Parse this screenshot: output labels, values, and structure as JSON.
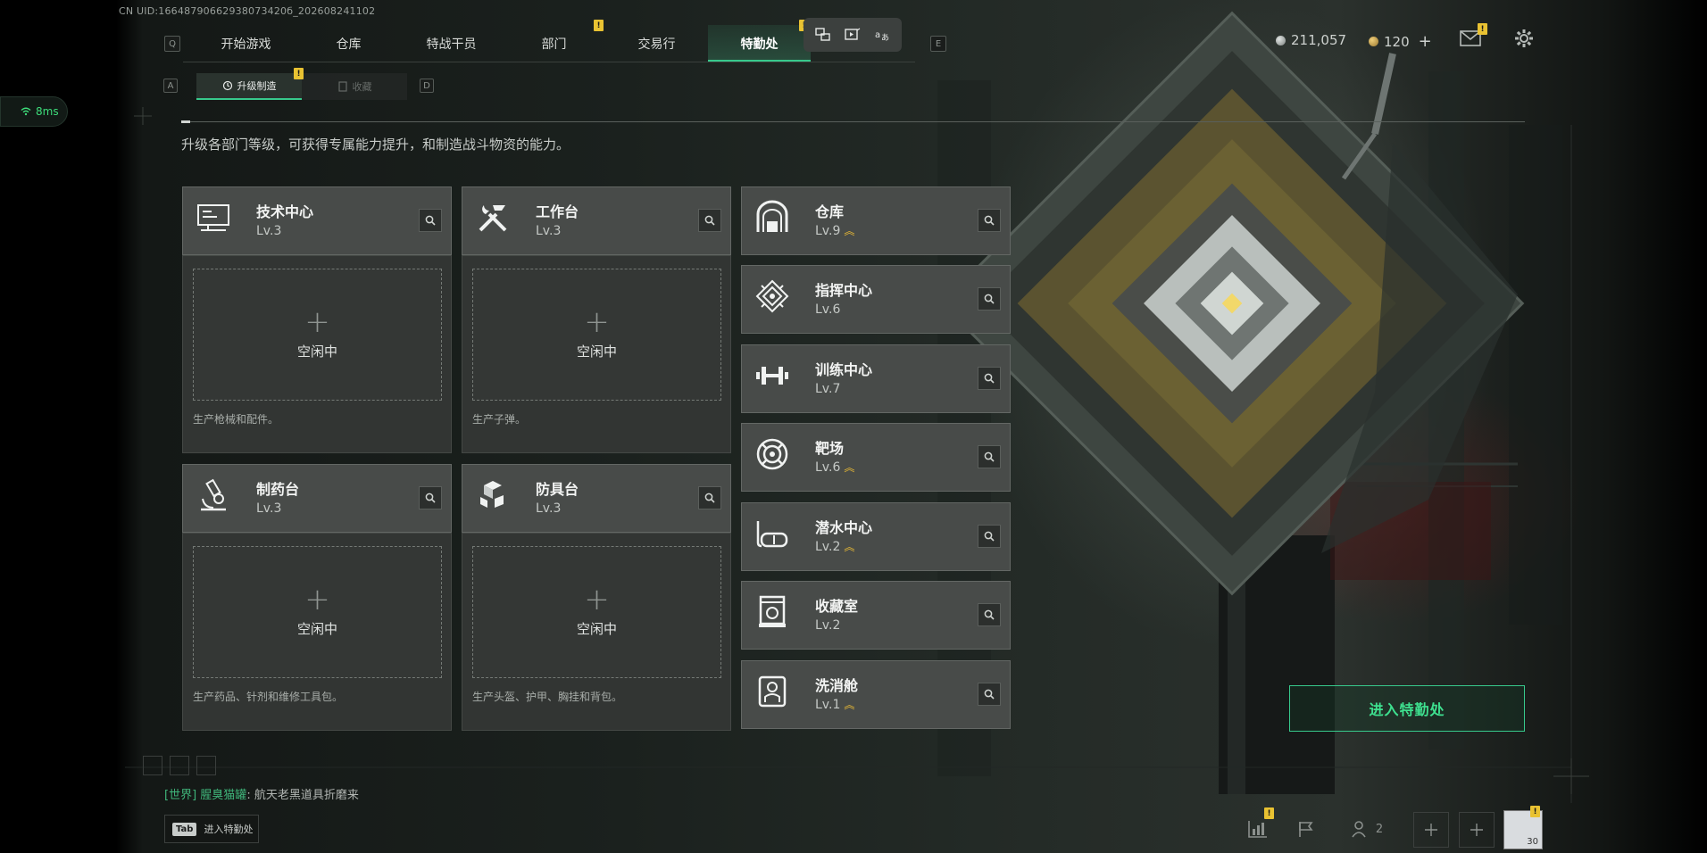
{
  "uid": "CN UID:16648790662938073420б_202608241102",
  "ping": {
    "value": "8ms"
  },
  "nav": {
    "left_key": "Q",
    "right_key": "E",
    "tabs": [
      {
        "label": "开始游戏"
      },
      {
        "label": "仓库"
      },
      {
        "label": "特战干员"
      },
      {
        "label": "部门",
        "badge": "!"
      },
      {
        "label": "交易行"
      },
      {
        "label": "特勤处",
        "active": true,
        "badge": "!"
      }
    ]
  },
  "float_tools": [
    "screenshot-icon",
    "record-icon",
    "translate-icon"
  ],
  "currency": {
    "silver": "211,057",
    "gold": "120",
    "gold_add": "+",
    "colors": {
      "silver": "#9da3a0",
      "gold": "#c9a04a"
    }
  },
  "top_icons": {
    "mail_badge": "!"
  },
  "subtabs": {
    "left_key": "A",
    "right_key": "D",
    "items": [
      {
        "label": "升级制造",
        "active": true,
        "badge": "!"
      },
      {
        "label": "收藏",
        "active": false
      }
    ]
  },
  "description": "升级各部门等级，可获得专属能力提升，和制造战斗物资的能力。",
  "production": [
    {
      "name": "技术中心",
      "level": "Lv.3",
      "icon": "computer-icon",
      "slot_plus": "+",
      "slot_text": "空闲中",
      "desc": "生产枪械和配件。"
    },
    {
      "name": "工作台",
      "level": "Lv.3",
      "icon": "tools-icon",
      "slot_plus": "+",
      "slot_text": "空闲中",
      "desc": "生产子弹。"
    },
    {
      "name": "制药台",
      "level": "Lv.3",
      "icon": "microscope-icon",
      "slot_plus": "+",
      "slot_text": "空闲中",
      "desc": "生产药品、针剂和维修工具包。"
    },
    {
      "name": "防具台",
      "level": "Lv.3",
      "icon": "cubes-icon",
      "slot_plus": "+",
      "slot_text": "空闲中",
      "desc": "生产头盔、护甲、胸挂和背包。"
    }
  ],
  "departments": [
    {
      "name": "仓库",
      "level": "Lv.9",
      "icon": "warehouse-icon",
      "upgradable": true
    },
    {
      "name": "指挥中心",
      "level": "Lv.6",
      "icon": "command-icon",
      "upgradable": false
    },
    {
      "name": "训练中心",
      "level": "Lv.7",
      "icon": "dumbbell-icon",
      "upgradable": false
    },
    {
      "name": "靶场",
      "level": "Lv.6",
      "icon": "target-icon",
      "upgradable": true
    },
    {
      "name": "潜水中心",
      "level": "Lv.2",
      "icon": "diving-mask-icon",
      "upgradable": true
    },
    {
      "name": "收藏室",
      "level": "Lv.2",
      "icon": "collection-icon",
      "upgradable": false
    },
    {
      "name": "洗消舱",
      "level": "Lv.1",
      "icon": "decon-icon",
      "upgradable": true
    }
  ],
  "enter_button": "进入特勤处",
  "chat": {
    "channel": "[世界]",
    "name": "腥臭猫罐",
    "separator": ":",
    "message": "航天老黑道具折磨来"
  },
  "tab_hint": {
    "key": "Tab",
    "label": "进入特勤处"
  },
  "bottom": {
    "stats_badge": "!",
    "friends_count": "2",
    "avatar_badge": "!",
    "avatar_level": "30"
  }
}
